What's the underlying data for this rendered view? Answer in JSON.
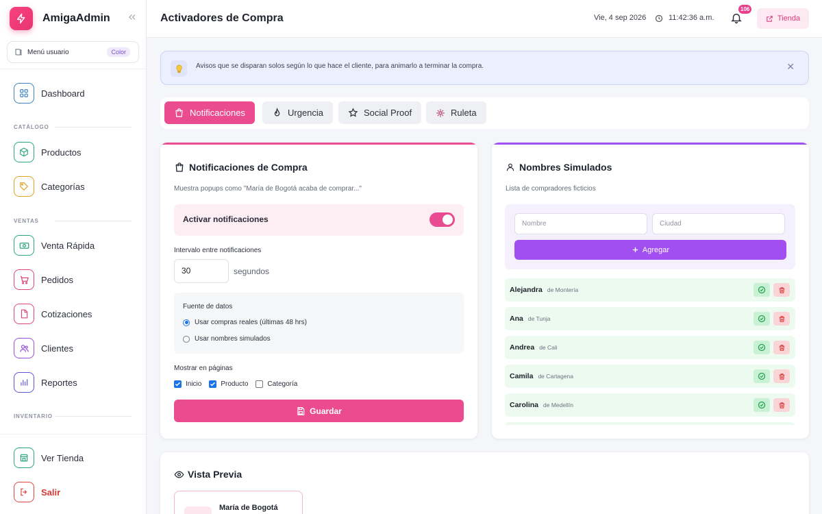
{
  "brand": {
    "name": "AmigaAdmin"
  },
  "user_menu": {
    "label": "Menú usuario",
    "badge": "Color"
  },
  "sidebar": {
    "sections": {
      "catalogo": "CATÁLOGO",
      "ventas": "VENTAS",
      "inventario": "INVENTARIO"
    },
    "items": {
      "dashboard": "Dashboard",
      "productos": "Productos",
      "categorias": "Categorías",
      "venta_rapida": "Venta Rápida",
      "pedidos": "Pedidos",
      "cotizaciones": "Cotizaciones",
      "clientes": "Clientes",
      "reportes": "Reportes"
    },
    "bottom": {
      "ver_tienda": "Ver Tienda",
      "salir": "Salir"
    }
  },
  "header": {
    "title": "Activadores de Compra",
    "date": "Vie, 4 sep 2026",
    "time": "11:42:36 a.m.",
    "notification_count": "106",
    "shop_button": "Tienda"
  },
  "banner": {
    "text": "Avisos que se disparan solos según lo que hace el cliente, para animarlo a terminar la compra."
  },
  "tabs": [
    {
      "label": "Notificaciones"
    },
    {
      "label": "Urgencia"
    },
    {
      "label": "Social Proof"
    },
    {
      "label": "Ruleta"
    }
  ],
  "notifications_card": {
    "title": "Notificaciones de Compra",
    "subtitle": "Muestra popups como \"María de Bogotá acaba de comprar...\"",
    "toggle_label": "Activar notificaciones",
    "toggle_on": true,
    "interval_label": "Intervalo entre notificaciones",
    "interval_value": "30",
    "interval_units": "segundos",
    "source_label": "Fuente de datos",
    "source_options": [
      "Usar compras reales (últimas 48 hrs)",
      "Usar nombres simulados"
    ],
    "pages_label": "Mostrar en páginas",
    "pages": [
      {
        "label": "Inicio",
        "checked": true
      },
      {
        "label": "Producto",
        "checked": true
      },
      {
        "label": "Categoría",
        "checked": false
      }
    ],
    "save_label": "Guardar"
  },
  "names_card": {
    "title": "Nombres Simulados",
    "subtitle": "Lista de compradores ficticios",
    "name_placeholder": "Nombre",
    "city_placeholder": "Ciudad",
    "add_label": "Agregar",
    "names": [
      {
        "name": "Alejandra",
        "city": "de Montería"
      },
      {
        "name": "Ana",
        "city": "de Tunja"
      },
      {
        "name": "Andrea",
        "city": "de Cali"
      },
      {
        "name": "Camila",
        "city": "de Cartagena"
      },
      {
        "name": "Carolina",
        "city": "de Medellín"
      }
    ]
  },
  "preview": {
    "title": "Vista Previa",
    "popup_name": "María de Bogotá"
  },
  "colors": {
    "accent": "#eb4b8f",
    "purple": "#a14ff0"
  }
}
